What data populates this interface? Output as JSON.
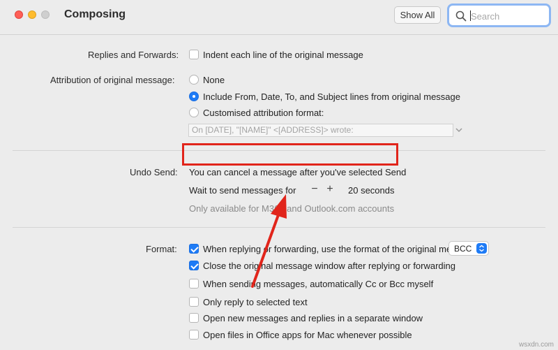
{
  "window": {
    "title": "Composing",
    "show_all": "Show All",
    "search_placeholder": "Search"
  },
  "replies": {
    "label": "Replies and Forwards:",
    "option": "Indent each line of the original message",
    "checked": false
  },
  "attribution": {
    "label": "Attribution of original message:",
    "options": [
      {
        "label": "None",
        "selected": false
      },
      {
        "label": "Include From, Date, To, and Subject lines from original message",
        "selected": true
      },
      {
        "label": "Customised attribution format:",
        "selected": false
      }
    ],
    "format_field": "On [DATE], \"[NAME]\" <[ADDRESS]> wrote:"
  },
  "undo_send": {
    "label": "Undo Send:",
    "description": "You can cancel a message after you've selected Send",
    "wait_label": "Wait to send messages for",
    "stepper_minus": "−",
    "stepper_plus": "+",
    "seconds": "20 seconds",
    "note": "Only available for M365 and Outlook.com accounts"
  },
  "format": {
    "label": "Format:",
    "options": [
      {
        "label": "When replying or forwarding, use the format of the original message",
        "checked": true
      },
      {
        "label": "Close the original message window after replying or forwarding",
        "checked": true
      },
      {
        "label": "When sending messages, automatically Cc or Bcc myself",
        "checked": false
      },
      {
        "label": "Only reply to selected text",
        "checked": false
      },
      {
        "label": "Open new messages and replies in a separate window",
        "checked": false
      },
      {
        "label": "Open files in Office apps for Mac whenever possible",
        "checked": false
      }
    ],
    "cc_bcc_value": "BCC"
  },
  "watermark": "wsxdn.com",
  "colors": {
    "accent": "#1e7bf6",
    "highlight": "#e1251b"
  }
}
